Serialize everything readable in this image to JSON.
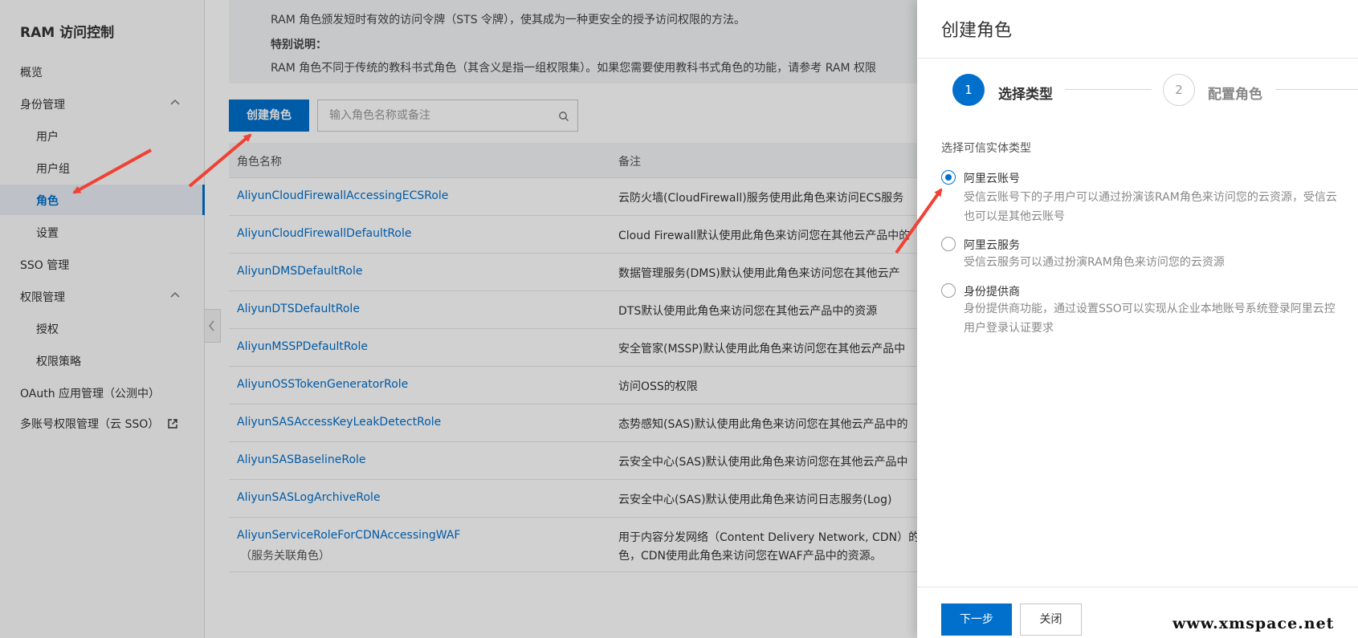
{
  "sidebar": {
    "title": "RAM 访问控制",
    "items": [
      {
        "label": "概览"
      },
      {
        "label": "身份管理",
        "expanded": true
      },
      {
        "label": "用户"
      },
      {
        "label": "用户组"
      },
      {
        "label": "角色",
        "active": true
      },
      {
        "label": "设置"
      },
      {
        "label": "SSO 管理"
      },
      {
        "label": "权限管理",
        "expanded": true
      },
      {
        "label": "授权"
      },
      {
        "label": "权限策略"
      },
      {
        "label": "OAuth 应用管理（公测中）"
      },
      {
        "label": "多账号权限管理（云 SSO）",
        "external": true
      }
    ]
  },
  "notice": {
    "line1": "RAM 角色颁发短时有效的访问令牌（STS 令牌），使其成为一种更安全的授予访问权限的方法。",
    "heading": "特别说明：",
    "line2": "RAM 角色不同于传统的教科书式角色（其含义是指一组权限集）。如果您需要使用教科书式角色的功能，请参考 RAM 权限"
  },
  "toolbar": {
    "create_label": "创建角色",
    "search_placeholder": "输入角色名称或备注"
  },
  "table": {
    "headers": [
      "角色名称",
      "备注"
    ],
    "rows": [
      {
        "name": "AliyunCloudFirewallAccessingECSRole",
        "note": "云防火墙(CloudFirewall)服务使用此角色来访问ECS服务"
      },
      {
        "name": "AliyunCloudFirewallDefaultRole",
        "note": "Cloud Firewall默认使用此角色来访问您在其他云产品中的"
      },
      {
        "name": "AliyunDMSDefaultRole",
        "note": "数据管理服务(DMS)默认使用此角色来访问您在其他云产"
      },
      {
        "name": "AliyunDTSDefaultRole",
        "note": "DTS默认使用此角色来访问您在其他云产品中的资源"
      },
      {
        "name": "AliyunMSSPDefaultRole",
        "note": "安全管家(MSSP)默认使用此角色来访问您在其他云产品中"
      },
      {
        "name": "AliyunOSSTokenGeneratorRole",
        "note": "访问OSS的权限"
      },
      {
        "name": "AliyunSASAccessKeyLeakDetectRole",
        "note": "态势感知(SAS)默认使用此角色来访问您在其他云产品中的"
      },
      {
        "name": "AliyunSASBaselineRole",
        "note": "云安全中心(SAS)默认使用此角色来访问您在其他云产品中"
      },
      {
        "name": "AliyunSASLogArchiveRole",
        "note": "云安全中心(SAS)默认使用此角色来访问日志服务(Log)"
      },
      {
        "name": "AliyunServiceRoleForCDNAccessingWAF",
        "sub": "（服务关联角色）",
        "note": "用于内容分发网络（Content Delivery Network, CDN）的",
        "note2": "色，CDN使用此角色来访问您在WAF产品中的资源。"
      }
    ]
  },
  "drawer": {
    "title": "创建角色",
    "steps": [
      {
        "number": "1",
        "label": "选择类型",
        "active": true
      },
      {
        "number": "2",
        "label": "配置角色",
        "active": false
      }
    ],
    "section_label": "选择可信实体类型",
    "options": [
      {
        "label": "阿里云账号",
        "checked": true,
        "desc1": "受信云账号下的子用户可以通过扮演该RAM角色来访问您的云资源，受信云",
        "desc2": "也可以是其他云账号"
      },
      {
        "label": "阿里云服务",
        "checked": false,
        "desc1": "受信云服务可以通过扮演RAM角色来访问您的云资源"
      },
      {
        "label": "身份提供商",
        "checked": false,
        "desc1": "身份提供商功能，通过设置SSO可以实现从企业本地账号系统登录阿里云控",
        "desc2": "用户登录认证要求"
      }
    ],
    "next_label": "下一步",
    "close_label": "关闭"
  },
  "watermark": "www.xmspace.net",
  "colors": {
    "accent": "#0070cc",
    "arrow": "#f04134"
  }
}
